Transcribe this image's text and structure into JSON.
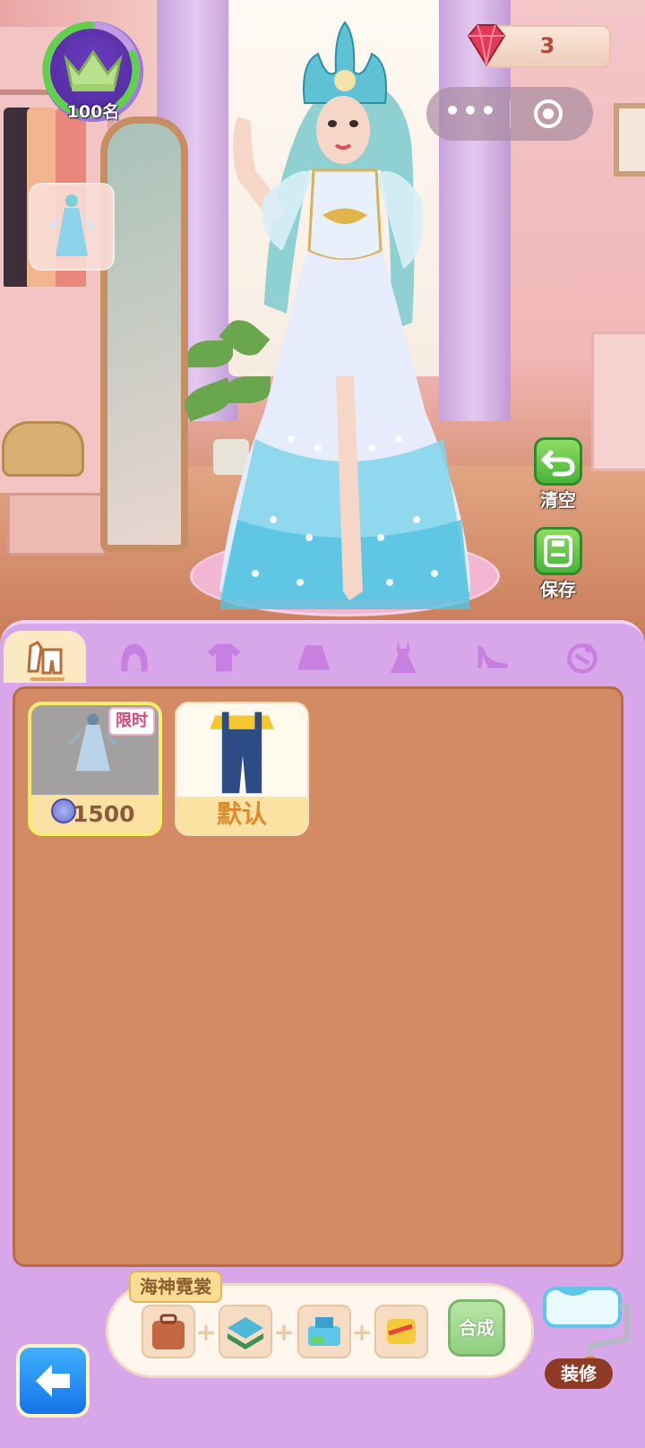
{
  "hud": {
    "rank_label": "100名",
    "gem_count": "3",
    "more_icon_text": "•••"
  },
  "side_actions": {
    "clear_label": "清空",
    "save_label": "保存"
  },
  "tabs": [
    {
      "icon": "outfit-set-icon",
      "active": true
    },
    {
      "icon": "hair-icon",
      "active": false
    },
    {
      "icon": "top-icon",
      "active": false
    },
    {
      "icon": "skirt-icon",
      "active": false
    },
    {
      "icon": "dress-icon",
      "active": false
    },
    {
      "icon": "high-heel-icon",
      "active": false
    },
    {
      "icon": "accessory-icon",
      "active": false
    }
  ],
  "items": [
    {
      "tag": "限时",
      "price": "1500",
      "selected": true
    },
    {
      "label": "默认",
      "selected": false
    }
  ],
  "recipe": {
    "title": "海神霓裳",
    "merge_label": "合成"
  },
  "decorate_label": "装修",
  "colors": {
    "panel": "#d8a7e9",
    "grid_bg": "#d48a63",
    "accent_green": "#46b53a",
    "back_blue": "#1474e6"
  }
}
